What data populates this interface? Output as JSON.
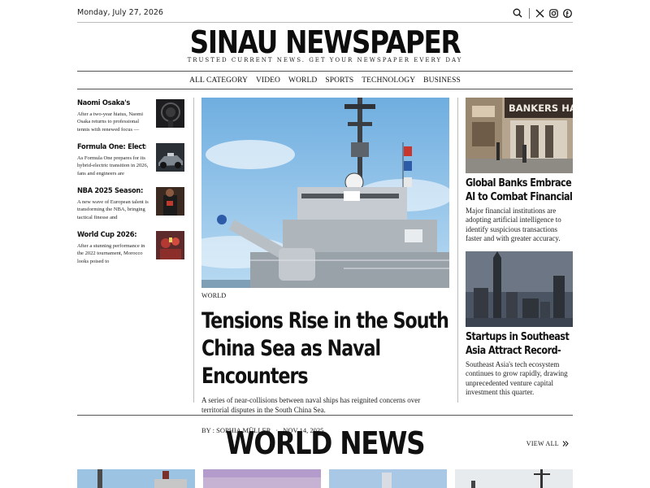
{
  "topbar": {
    "date": "Monday, July 27, 2026",
    "icons": [
      "search-icon",
      "x-twitter-icon",
      "instagram-icon",
      "facebook-icon"
    ]
  },
  "masthead": {
    "title": "SINAU NEWSPAPER",
    "tagline": "TRUSTED CURRENT NEWS. GET YOUR NEWSPAPER EVERY DAY"
  },
  "nav": {
    "items": [
      "ALL CATEGORY",
      "VIDEO",
      "WORLD",
      "SPORTS",
      "TECHNOLOGY",
      "BUSINESS"
    ]
  },
  "left_stories": [
    {
      "title": "Naomi Osaka's",
      "excerpt": "After a two-year hiatus, Naomi Osaka returns to professional tennis with renewed focus —"
    },
    {
      "title": "Formula One: Electric Era",
      "excerpt": "As Formula One prepares for its hybrid-electric transition in 2026, fans and engineers are"
    },
    {
      "title": "NBA 2025 Season:",
      "excerpt": "A new wave of European talent is transforming the NBA, bringing tactical finesse and"
    },
    {
      "title": "World Cup 2026:",
      "excerpt": "After a stunning performance in the 2022 tournament, Morocco looks poised to"
    }
  ],
  "main_story": {
    "category": "WORLD",
    "headline": "Tensions Rise in the South China Sea as Naval Encounters",
    "summary": "A series of near-collisions between naval ships has reignited concerns over territorial disputes in the South China Sea.",
    "byline": "BY : SOPHIA MÜLLER",
    "date": "NOV 14, 2025"
  },
  "right_stories": [
    {
      "title": "Global Banks Embrace AI to Combat Financial",
      "summary": "Major financial institutions are adopting artificial intelligence to identify suspicious transactions faster and with greater accuracy."
    },
    {
      "title": "Startups in Southeast Asia Attract Record-",
      "summary": "Southeast Asia's tech ecosystem continues to grow rapidly, drawing unprecedented venture capital investment this quarter."
    }
  ],
  "bank_sign": "BANKERS HA",
  "world_news": {
    "title": "WORLD NEWS",
    "view_all": "VIEW ALL"
  },
  "colors": {
    "text": "#111111",
    "rule": "#bdbdbd",
    "sky": "#8fbfe6"
  }
}
